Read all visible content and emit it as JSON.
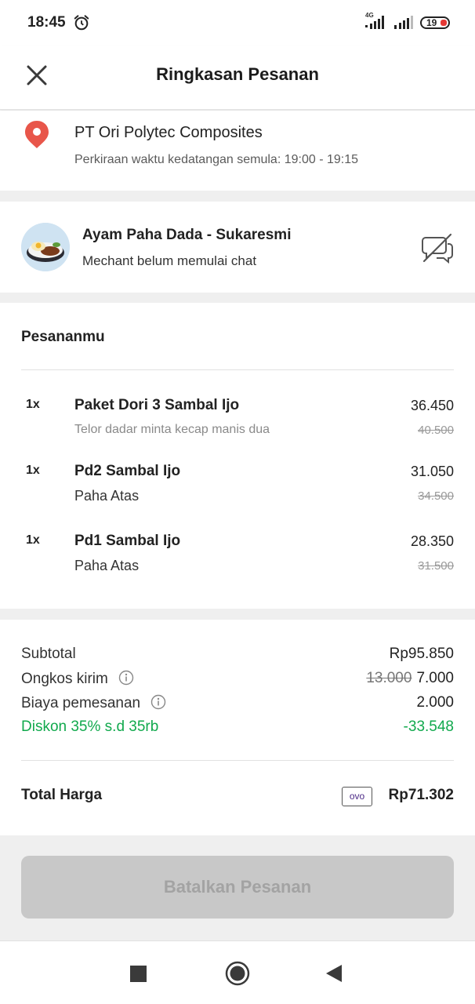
{
  "status_bar": {
    "time": "18:45",
    "network": "4G",
    "battery": "19",
    "icons": [
      "alarm-icon",
      "signal-icon",
      "battery-icon"
    ]
  },
  "header": {
    "title": "Ringkasan Pesanan",
    "close_icon": "close-icon"
  },
  "address": {
    "name": "PT Ori Polytec Composites",
    "eta": "Perkiraan waktu kedatangan semula: 19:00 - 19:15",
    "icon": "location-pin-icon",
    "icon_color": "#e8564a"
  },
  "merchant": {
    "name": "Ayam Paha Dada - Sukaresmi",
    "status": "Mechant belum memulai chat",
    "chat_icon": "chat-disabled-icon"
  },
  "orders": {
    "title": "Pesananmu",
    "items": [
      {
        "qty": "1x",
        "name": "Paket Dori 3 Sambal Ijo",
        "note": "Telor dadar minta kecap manis dua",
        "price": "36.450",
        "old_price": "40.500"
      },
      {
        "qty": "1x",
        "name": "Pd2 Sambal Ijo",
        "note": "Paha Atas",
        "price": "31.050",
        "old_price": "34.500"
      },
      {
        "qty": "1x",
        "name": "Pd1 Sambal Ijo",
        "note": "Paha Atas",
        "price": "28.350",
        "old_price": "31.500"
      }
    ]
  },
  "summary": {
    "subtotal_label": "Subtotal",
    "subtotal_value": "Rp95.850",
    "delivery_label": "Ongkos kirim",
    "delivery_old": "13.000",
    "delivery_value": "7.000",
    "fee_label": "Biaya pemesanan",
    "fee_value": "2.000",
    "discount_label": "Diskon 35% s.d 35rb",
    "discount_value": "-33.548",
    "discount_color": "#11a94d",
    "total_label": "Total Harga",
    "payment_method": "OVO",
    "total_value": "Rp71.302"
  },
  "actions": {
    "cancel_label": "Batalkan Pesanan"
  },
  "nav": {
    "icons": [
      "recent-apps-icon",
      "home-icon",
      "back-icon"
    ]
  }
}
